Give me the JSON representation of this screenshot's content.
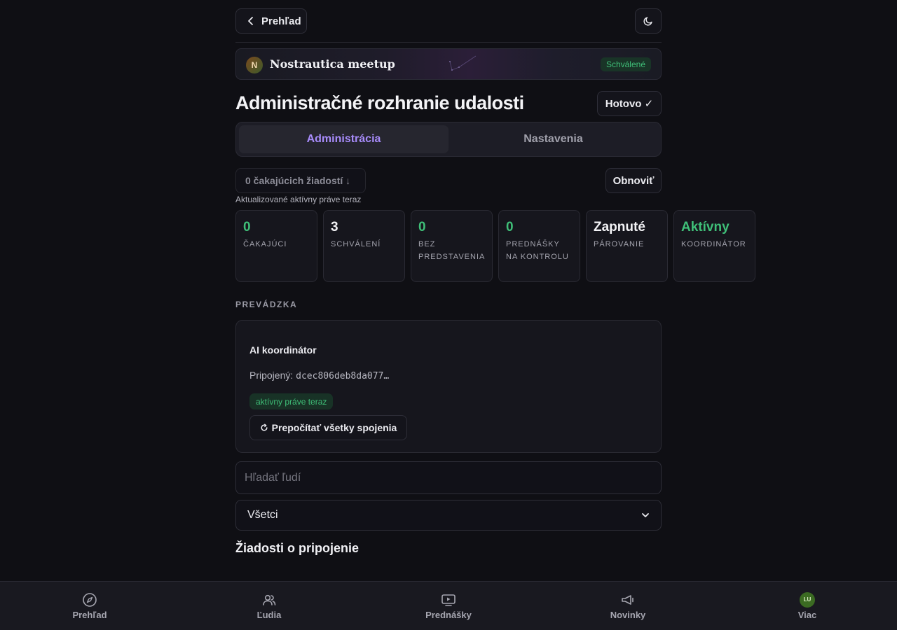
{
  "topbar": {
    "back_label": "Prehľad"
  },
  "event": {
    "avatar_letter": "N",
    "name": "Nostrautica meetup",
    "status": "Schválené"
  },
  "header": {
    "title": "Administračné rozhranie udalosti",
    "done_label": "Hotovo ✓"
  },
  "tabs": [
    {
      "label": "Administrácia",
      "active": true
    },
    {
      "label": "Nastavenia",
      "active": false
    }
  ],
  "requests": {
    "pending_label": "0 čakajúcich žiadostí ↓",
    "refresh_label": "Obnoviť",
    "updated_note": "Aktualizované aktívny práve teraz"
  },
  "stats": [
    {
      "value": "0",
      "label": "Čakajúci",
      "color": "#3fbf78"
    },
    {
      "value": "3",
      "label": "Schválení",
      "color": "#f2f2f5"
    },
    {
      "value": "0",
      "label": "Bez predstavenia",
      "color": "#3fbf78"
    },
    {
      "value": "0",
      "label": "Prednášky na kontrolu",
      "color": "#3fbf78"
    },
    {
      "value": "Zapnuté",
      "label": "Párovanie",
      "color": "#f2f2f5"
    },
    {
      "value": "Aktívny",
      "label": "Koordinátor",
      "color": "#3fbf78"
    }
  ],
  "operations": {
    "section_label": "PREVÁDZKA",
    "ai_title": "AI koordinátor",
    "connected_prefix": "Pripojený: ",
    "connected_key": "dcec806deb8da077…",
    "status_badge": "aktívny práve teraz",
    "recalc_label": "Prepočítať všetky spojenia"
  },
  "search": {
    "placeholder": "Hľadať ľudí"
  },
  "filter": {
    "selected": "Všetci"
  },
  "join_requests": {
    "title": "Žiadosti o pripojenie"
  },
  "bottom_nav": [
    {
      "label": "Prehľad",
      "icon": "compass-icon"
    },
    {
      "label": "Ľudia",
      "icon": "people-icon"
    },
    {
      "label": "Prednášky",
      "icon": "video-icon"
    },
    {
      "label": "Novinky",
      "icon": "megaphone-icon"
    },
    {
      "label": "Viac",
      "icon": "avatar",
      "avatar_initials": "LU"
    }
  ],
  "colors": {
    "accent": "#a78bfa",
    "success": "#3fbf78",
    "background": "#0f0f14"
  }
}
